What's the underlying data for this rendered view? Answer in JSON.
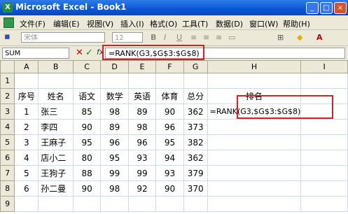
{
  "window": {
    "title": "Microsoft Excel - Book1",
    "app_icon_letter": "X",
    "minimize": "_",
    "maximize": "□",
    "close": "×"
  },
  "menu": [
    "文件(F)",
    "编辑(E)",
    "视图(V)",
    "插入(I)",
    "格式(O)",
    "工具(T)",
    "数据(D)",
    "窗口(W)",
    "帮助(H)"
  ],
  "toolbar": {
    "font_name": "宋体",
    "font_size": "12",
    "bold": "B",
    "italic": "I",
    "underline": "U"
  },
  "formula_bar": {
    "name_box": "SUM",
    "cancel": "✕",
    "enter": "✓",
    "fx": "fx",
    "formula": "=RANK(G3,$G$3:$G$8)"
  },
  "sheet": {
    "columns": [
      "A",
      "B",
      "C",
      "D",
      "E",
      "F",
      "G",
      "H",
      "I"
    ],
    "row_numbers": [
      "1",
      "2",
      "3",
      "4",
      "5",
      "6",
      "7",
      "8",
      "9"
    ],
    "rows": [
      [
        "",
        "",
        "",
        "",
        "",
        "",
        "",
        "",
        ""
      ],
      [
        "序号",
        "姓名",
        "语文",
        "数学",
        "英语",
        "体育",
        "总分",
        "排名",
        ""
      ],
      [
        "1",
        "张三",
        "85",
        "98",
        "89",
        "90",
        "362",
        "=RANK(G3,$G$3:$G$8)",
        ""
      ],
      [
        "2",
        "李四",
        "90",
        "89",
        "98",
        "96",
        "373",
        "",
        ""
      ],
      [
        "3",
        "王麻子",
        "95",
        "96",
        "96",
        "95",
        "382",
        "",
        ""
      ],
      [
        "4",
        "店小二",
        "80",
        "95",
        "93",
        "94",
        "362",
        "",
        ""
      ],
      [
        "5",
        "王狗子",
        "88",
        "99",
        "99",
        "93",
        "379",
        "",
        ""
      ],
      [
        "6",
        "孙二曼",
        "90",
        "98",
        "92",
        "90",
        "370",
        "",
        ""
      ],
      [
        "",
        "",
        "",
        "",
        "",
        "",
        "",
        "",
        ""
      ]
    ]
  }
}
